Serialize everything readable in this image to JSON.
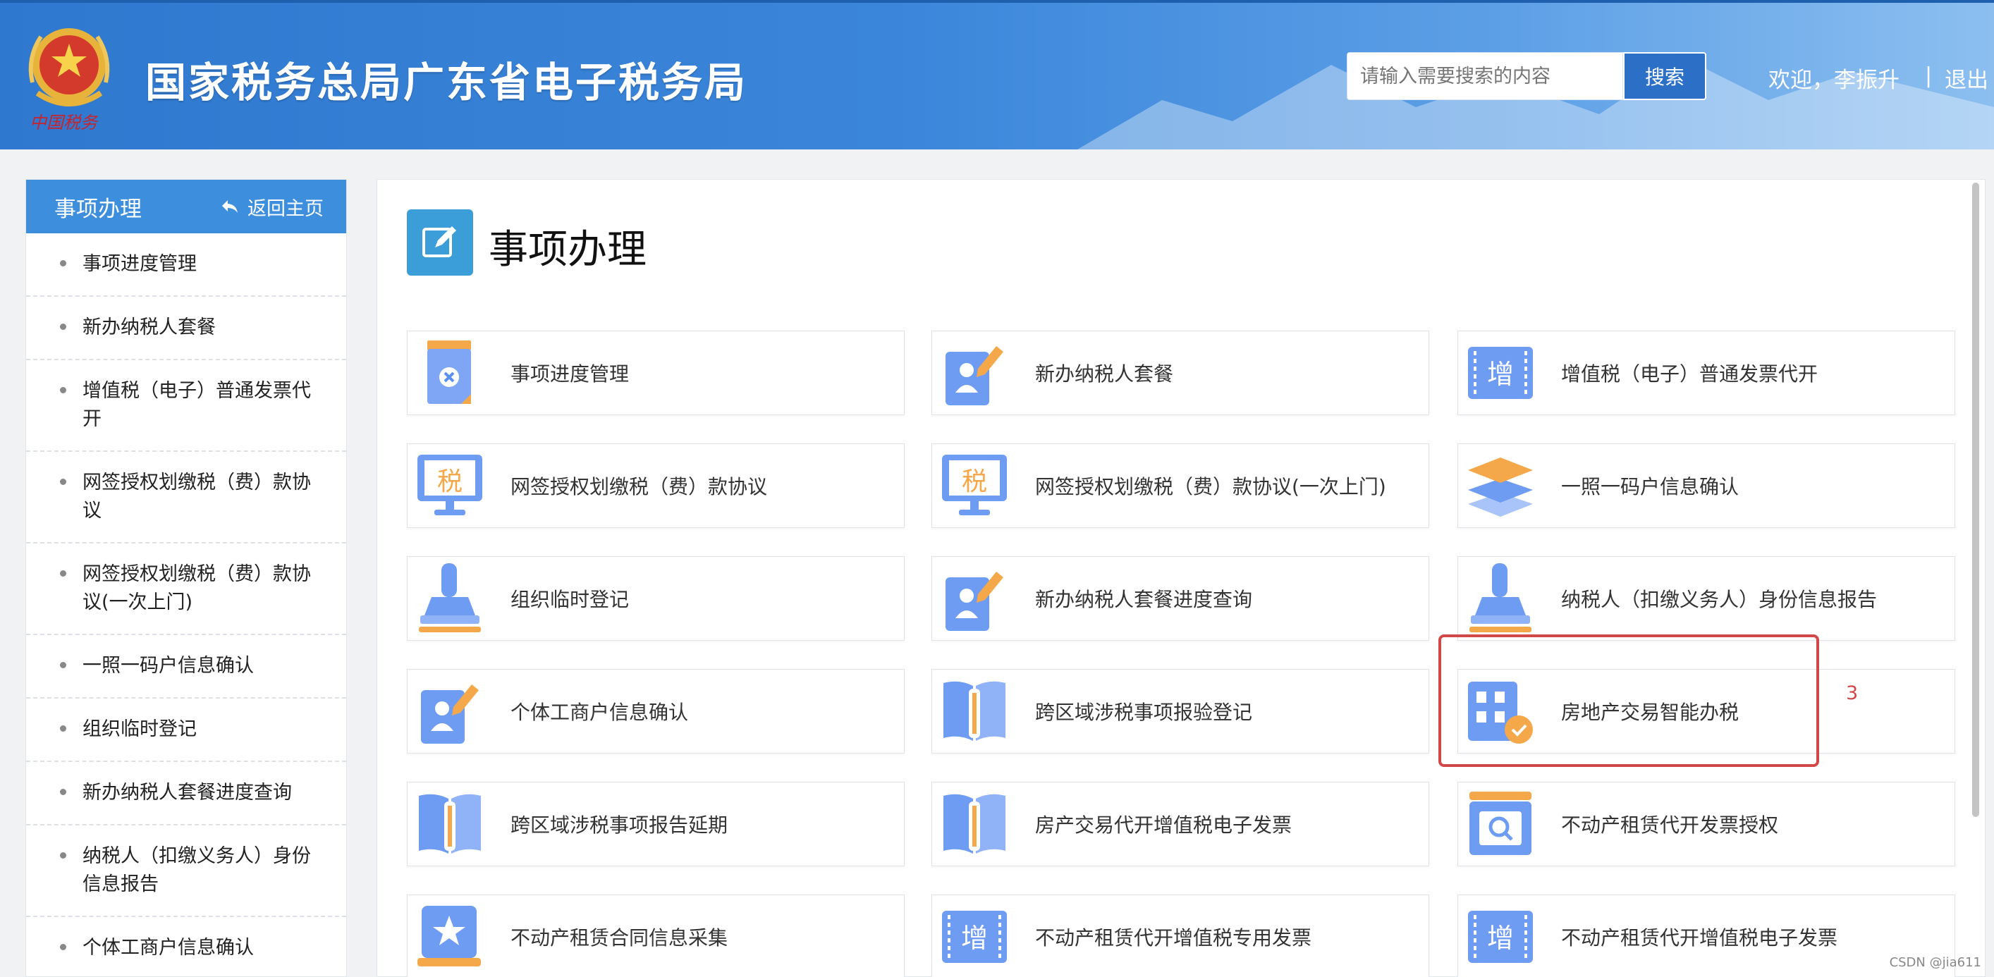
{
  "header": {
    "site_title": "国家税务总局广东省电子税务局",
    "emblem_caption": "中国税务",
    "search_placeholder": "请输入需要搜索的内容",
    "search_button": "搜索",
    "welcome": "欢迎，李振升",
    "separator": "|",
    "logout": "退出"
  },
  "sidebar": {
    "title": "事项办理",
    "back_label": "返回主页",
    "items": [
      {
        "label": "事项进度管理",
        "lines": 1
      },
      {
        "label": "新办纳税人套餐",
        "lines": 1
      },
      {
        "label": "增值税（电子）普通发票代开",
        "lines": 2
      },
      {
        "label": "网签授权划缴税（费）款协议",
        "lines": 2
      },
      {
        "label": "网签授权划缴税（费）款协议(一次上门)",
        "lines": 2
      },
      {
        "label": "一照一码户信息确认",
        "lines": 1
      },
      {
        "label": "组织临时登记",
        "lines": 1
      },
      {
        "label": "新办纳税人套餐进度查询",
        "lines": 1
      },
      {
        "label": "纳税人（扣缴义务人）身份信息报告",
        "lines": 2
      },
      {
        "label": "个体工商户信息确认",
        "lines": 1
      }
    ]
  },
  "main": {
    "title": "事项办理",
    "highlight_number": "3",
    "cards": [
      {
        "label": "事项进度管理",
        "icon": "document-cancel-icon"
      },
      {
        "label": "新办纳税人套餐",
        "icon": "user-edit-icon"
      },
      {
        "label": "增值税（电子）普通发票代开",
        "icon": "vat-ticket-icon"
      },
      {
        "label": "网签授权划缴税（费）款协议",
        "icon": "tax-monitor-icon"
      },
      {
        "label": "网签授权划缴税（费）款协议(一次上门)",
        "icon": "tax-monitor-icon"
      },
      {
        "label": "一照一码户信息确认",
        "icon": "layers-icon"
      },
      {
        "label": "组织临时登记",
        "icon": "stamp-icon"
      },
      {
        "label": "新办纳税人套餐进度查询",
        "icon": "user-edit-icon"
      },
      {
        "label": "纳税人（扣缴义务人）身份信息报告",
        "icon": "stamp-icon"
      },
      {
        "label": "个体工商户信息确认",
        "icon": "user-edit-icon"
      },
      {
        "label": "跨区域涉税事项报验登记",
        "icon": "book-icon"
      },
      {
        "label": "房地产交易智能办税",
        "icon": "building-check-icon"
      },
      {
        "label": "跨区域涉税事项报告延期",
        "icon": "book-icon"
      },
      {
        "label": "房产交易代开增值税电子发票",
        "icon": "book-icon"
      },
      {
        "label": "不动产租赁代开发票授权",
        "icon": "search-window-icon"
      },
      {
        "label": "不动产租赁合同信息采集",
        "icon": "star-book-icon"
      },
      {
        "label": "不动产租赁代开增值税专用发票",
        "icon": "vat-ticket-icon"
      },
      {
        "label": "不动产租赁代开增值税电子发票",
        "icon": "vat-ticket-icon"
      }
    ]
  },
  "watermark": "CSDN @jia611",
  "colors": {
    "header_blue": "#3b86db",
    "sidebar_head": "#3d8fde",
    "highlight_red": "#d24848",
    "icon_blue": "#5b8ff0",
    "icon_orange": "#f5a84a"
  }
}
